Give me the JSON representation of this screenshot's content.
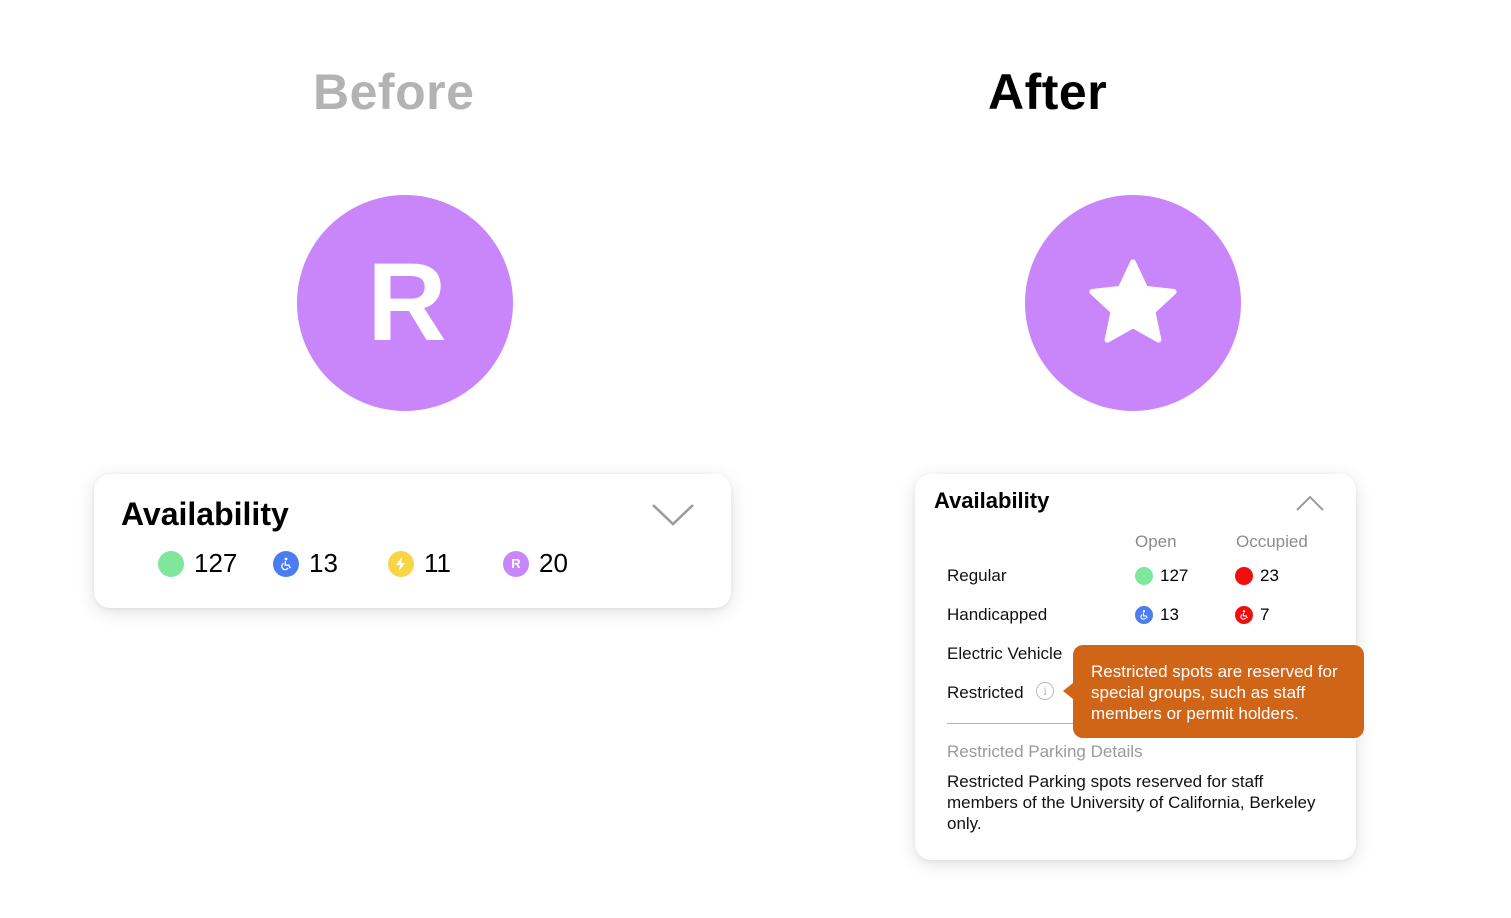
{
  "before": {
    "heading": "Before",
    "marker_letter": "R",
    "card": {
      "title": "Availability",
      "items": [
        {
          "icon": "regular-dot",
          "color": "#7ee79b",
          "count": "127"
        },
        {
          "icon": "handicapped-icon",
          "color": "#4c7df0",
          "count": "13"
        },
        {
          "icon": "lightning-icon",
          "color": "#f9d447",
          "count": "11"
        },
        {
          "icon": "restricted-icon",
          "color": "#c986fa",
          "letter": "R",
          "count": "20"
        }
      ]
    }
  },
  "after": {
    "heading": "After",
    "marker_icon": "star-icon",
    "card": {
      "title": "Availability",
      "columns": [
        "Open",
        "Occupied"
      ],
      "rows": [
        {
          "label": "Regular",
          "open": "127",
          "occupied": "23"
        },
        {
          "label": "Handicapped",
          "open": "13",
          "occupied": "7"
        },
        {
          "label": "Electric Vehicle"
        },
        {
          "label": "Restricted"
        }
      ],
      "details_title": "Restricted Parking Details",
      "details_text": "Restricted Parking spots reserved for staff members of the University of California, Berkeley only.",
      "tooltip": "Restricted spots are reserved for special groups, such as staff members or permit holders."
    }
  },
  "colors": {
    "marker": "#c986fa",
    "open_regular": "#7ee79b",
    "open_handicapped": "#4c7df0",
    "occupied": "#ef0f0f",
    "tooltip": "#d06417"
  }
}
